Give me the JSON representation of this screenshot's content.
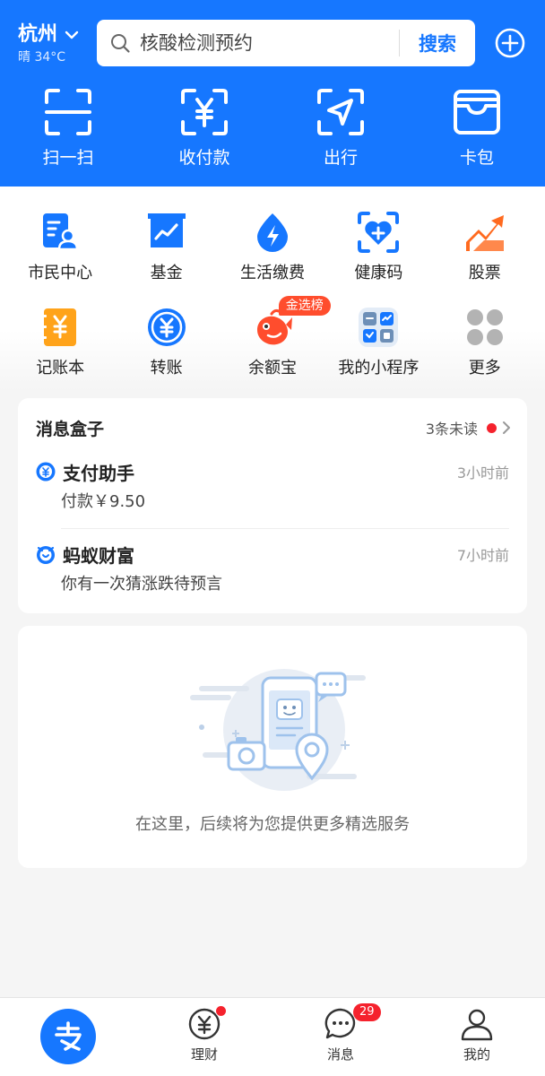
{
  "header": {
    "city": "杭州",
    "weather": "晴 34°C",
    "search_placeholder": "核酸检测预约",
    "search_button": "搜索",
    "quick_actions": [
      {
        "label": "扫一扫",
        "icon": "scan-icon"
      },
      {
        "label": "收付款",
        "icon": "pay-receive-icon"
      },
      {
        "label": "出行",
        "icon": "travel-icon"
      },
      {
        "label": "卡包",
        "icon": "card-wallet-icon"
      }
    ]
  },
  "grid": {
    "row1": [
      {
        "label": "市民中心",
        "icon": "citizen-center-icon"
      },
      {
        "label": "基金",
        "icon": "fund-icon"
      },
      {
        "label": "生活缴费",
        "icon": "utility-bill-icon"
      },
      {
        "label": "健康码",
        "icon": "health-code-icon"
      },
      {
        "label": "股票",
        "icon": "stock-icon"
      }
    ],
    "row2": [
      {
        "label": "记账本",
        "icon": "ledger-icon"
      },
      {
        "label": "转账",
        "icon": "transfer-icon"
      },
      {
        "label": "余额宝",
        "icon": "yuebao-icon",
        "badge": "金选榜"
      },
      {
        "label": "我的小程序",
        "icon": "mini-programs-icon"
      },
      {
        "label": "更多",
        "icon": "more-icon"
      }
    ]
  },
  "messages": {
    "title": "消息盒子",
    "unread": "3条未读",
    "items": [
      {
        "sender": "支付助手",
        "time": "3小时前",
        "body": "付款￥9.50",
        "icon": "payment-assistant-icon"
      },
      {
        "sender": "蚂蚁财富",
        "time": "7小时前",
        "body": "你有一次猜涨跌待预言",
        "icon": "ant-fortune-icon"
      }
    ]
  },
  "empty_card": {
    "text": "在这里，后续将为您提供更多精选服务"
  },
  "tabbar": {
    "tabs": [
      {
        "label": "",
        "icon": "alipay-home-icon"
      },
      {
        "label": "理财",
        "icon": "wealth-icon"
      },
      {
        "label": "消息",
        "icon": "messages-icon",
        "count": "29"
      },
      {
        "label": "我的",
        "icon": "profile-icon"
      }
    ]
  },
  "colors": {
    "brand_blue": "#1677ff",
    "badge_red": "#f5222d",
    "orange": "#ff6a1f"
  }
}
